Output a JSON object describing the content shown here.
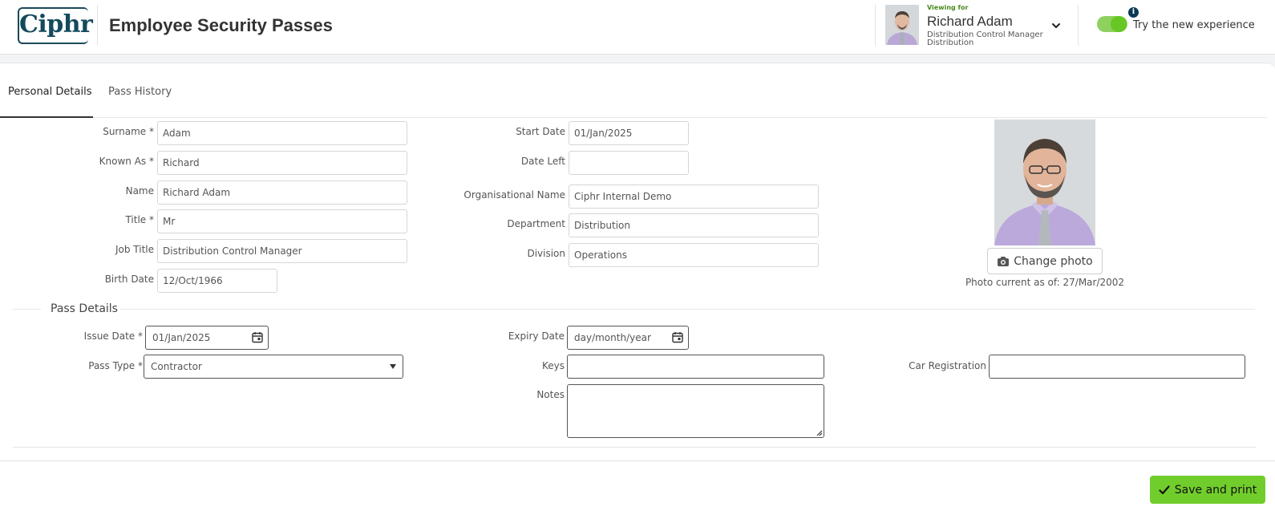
{
  "header": {
    "logo_text": "Ciphr",
    "app_title": "Employee Security Passes",
    "viewing_for_label": "Viewing for",
    "viewing_name": "Richard Adam",
    "viewing_job": "Distribution Control Manager",
    "viewing_dept": "Distribution",
    "toggle_label": "Try the new experience",
    "toggle_on": true,
    "info_glyph": "i"
  },
  "tabs": [
    {
      "label": "Personal Details",
      "active": true
    },
    {
      "label": "Pass History",
      "active": false
    }
  ],
  "personal": {
    "surname_label": "Surname *",
    "surname": "Adam",
    "known_as_label": "Known As *",
    "known_as": "Richard",
    "name_label": "Name",
    "name": "Richard Adam",
    "title_label": "Title *",
    "title": "Mr",
    "job_title_label": "Job Title",
    "job_title": "Distribution Control Manager",
    "birth_date_label": "Birth Date",
    "birth_date": "12/Oct/1966",
    "start_date_label": "Start Date",
    "start_date": "01/Jan/2025",
    "date_left_label": "Date Left",
    "date_left": "",
    "org_name_label": "Organisational Name",
    "org_name": "Ciphr Internal Demo",
    "department_label": "Department",
    "department": "Distribution",
    "division_label": "Division",
    "division": "Operations"
  },
  "photo": {
    "change_label": "Change photo",
    "caption": "Photo current as of: 27/Mar/2002"
  },
  "pass": {
    "legend": "Pass Details",
    "issue_date_label": "Issue Date *",
    "issue_date": "01/Jan/2025",
    "expiry_date_label": "Expiry Date",
    "expiry_date_placeholder": "day/month/year",
    "pass_type_label": "Pass Type *",
    "pass_type": "Contractor",
    "keys_label": "Keys",
    "keys": "",
    "notes_label": "Notes",
    "notes": "",
    "car_reg_label": "Car Registration",
    "car_reg": ""
  },
  "actions": {
    "save_label": "Save and print"
  },
  "colors": {
    "brand": "#134a5c",
    "accent_green": "#71cd2c",
    "toggle_green": "#67c724"
  }
}
